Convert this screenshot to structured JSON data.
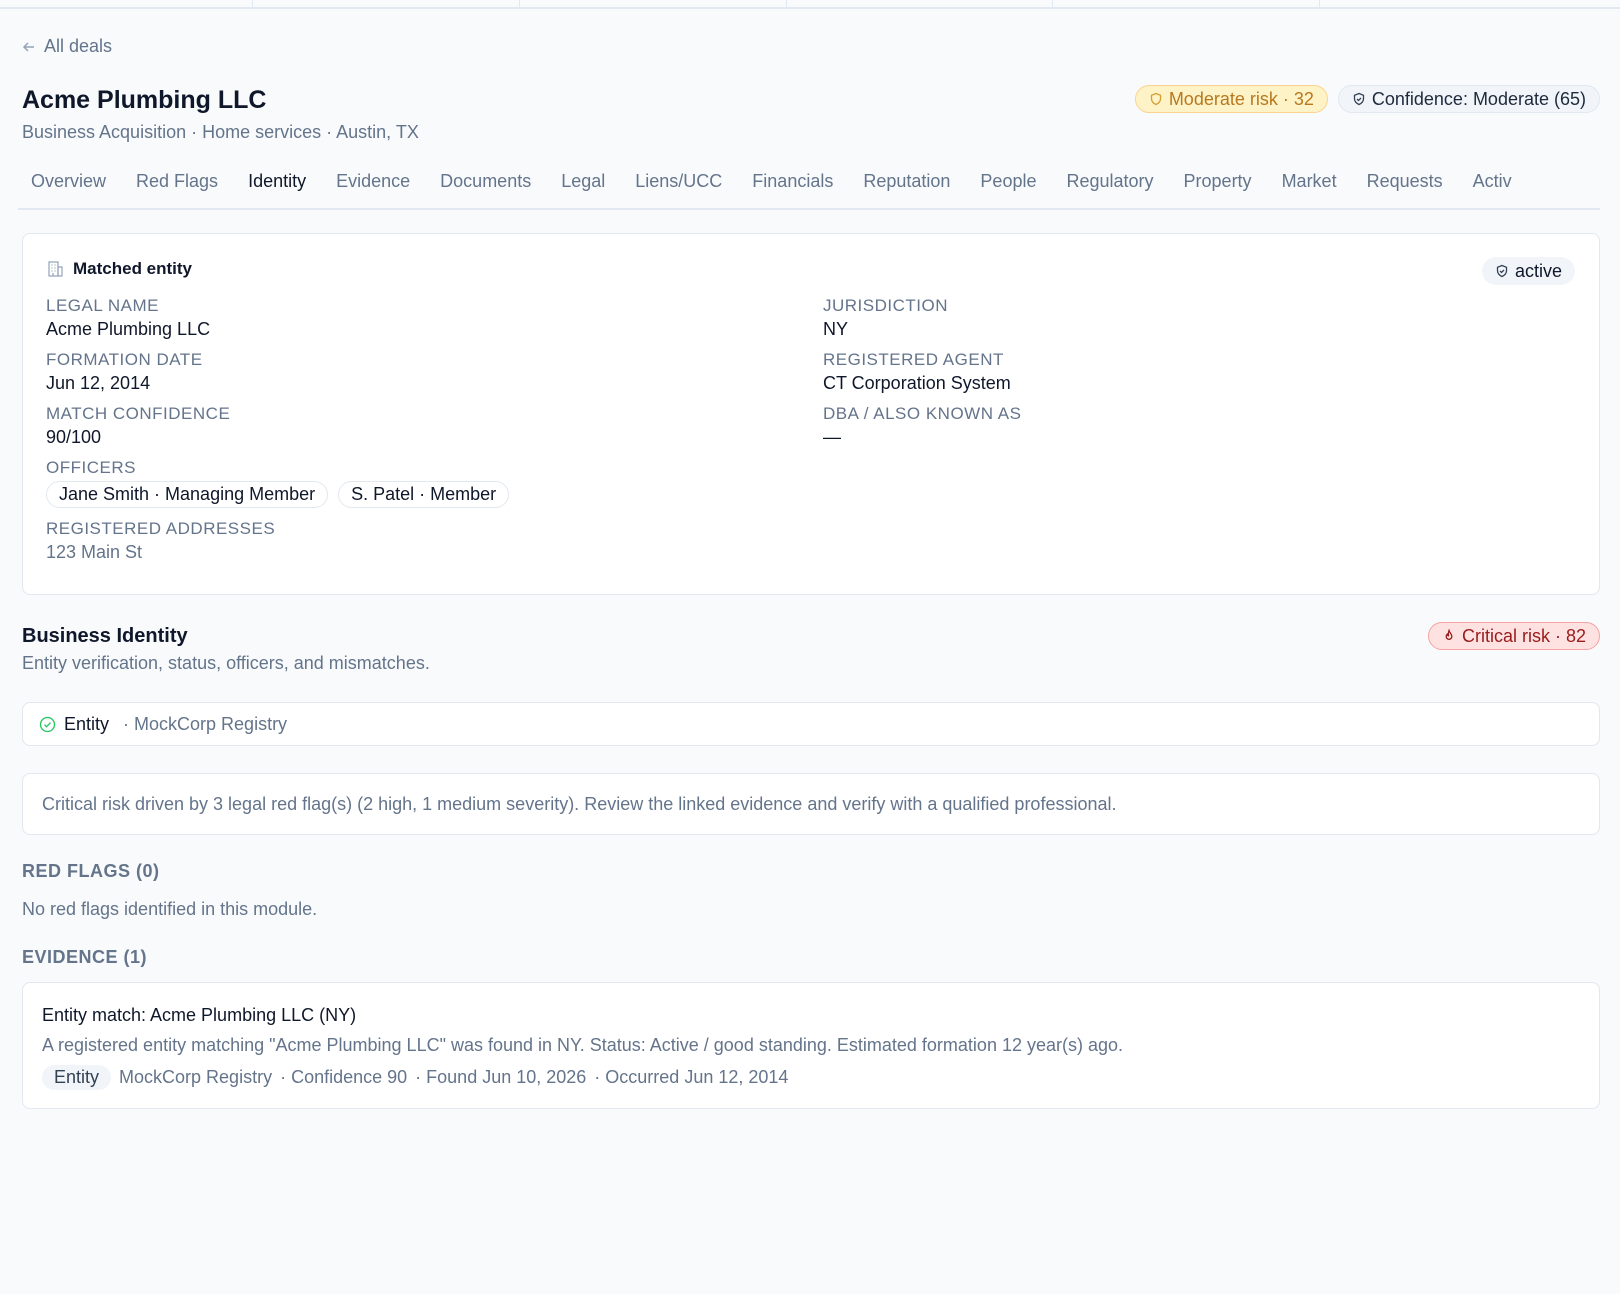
{
  "nav": {
    "back_label": "All deals"
  },
  "header": {
    "title": "Acme Plumbing LLC",
    "subtitle": "Business Acquisition · Home services · Austin, TX",
    "risk_badge": "Moderate risk · 32",
    "confidence_badge": "Confidence: Moderate (65)"
  },
  "tabs": [
    {
      "label": "Overview"
    },
    {
      "label": "Red Flags"
    },
    {
      "label": "Identity",
      "active": true
    },
    {
      "label": "Evidence"
    },
    {
      "label": "Documents"
    },
    {
      "label": "Legal"
    },
    {
      "label": "Liens/UCC"
    },
    {
      "label": "Financials"
    },
    {
      "label": "Reputation"
    },
    {
      "label": "People"
    },
    {
      "label": "Regulatory"
    },
    {
      "label": "Property"
    },
    {
      "label": "Market"
    },
    {
      "label": "Requests"
    },
    {
      "label": "Activ"
    }
  ],
  "entity": {
    "heading": "Matched entity",
    "status": "active",
    "legal_name_label": "LEGAL NAME",
    "legal_name": "Acme Plumbing LLC",
    "formation_label": "FORMATION DATE",
    "formation": "Jun 12, 2014",
    "match_label": "MATCH CONFIDENCE",
    "match": "90/100",
    "officers_label": "OFFICERS",
    "officers": [
      "Jane Smith · Managing Member",
      "S. Patel · Member"
    ],
    "addresses_label": "REGISTERED ADDRESSES",
    "addresses": "123 Main St",
    "jurisdiction_label": "JURISDICTION",
    "jurisdiction": "NY",
    "agent_label": "REGISTERED AGENT",
    "agent": "CT Corporation System",
    "dba_label": "DBA / ALSO KNOWN AS",
    "dba": "—"
  },
  "module": {
    "title": "Business Identity",
    "subtitle": "Entity verification, status, officers, and mismatches.",
    "risk_badge": "Critical risk · 82",
    "source_label": "Entity",
    "source_name": "· MockCorp Registry",
    "summary": "Critical risk driven by 3 legal red flag(s) (2 high, 1 medium severity). Review the linked evidence and verify with a qualified professional.",
    "red_flags_heading": "RED FLAGS (0)",
    "red_flags_empty": "No red flags identified in this module.",
    "evidence_heading": "EVIDENCE (1)"
  },
  "evidence": [
    {
      "title": "Entity match: Acme Plumbing LLC (NY)",
      "description": "A registered entity matching \"Acme Plumbing LLC\" was found in NY. Status: Active / good standing. Estimated formation 12 year(s) ago.",
      "tag": "Entity",
      "source": "MockCorp Registry",
      "confidence": "· Confidence 90",
      "found": "· Found Jun 10, 2026",
      "occurred": "· Occurred Jun 12, 2014"
    }
  ],
  "colors": {
    "moderate": "#b7791f",
    "critical": "#991b1b",
    "success": "#22c55e",
    "muted": "#64748b"
  }
}
